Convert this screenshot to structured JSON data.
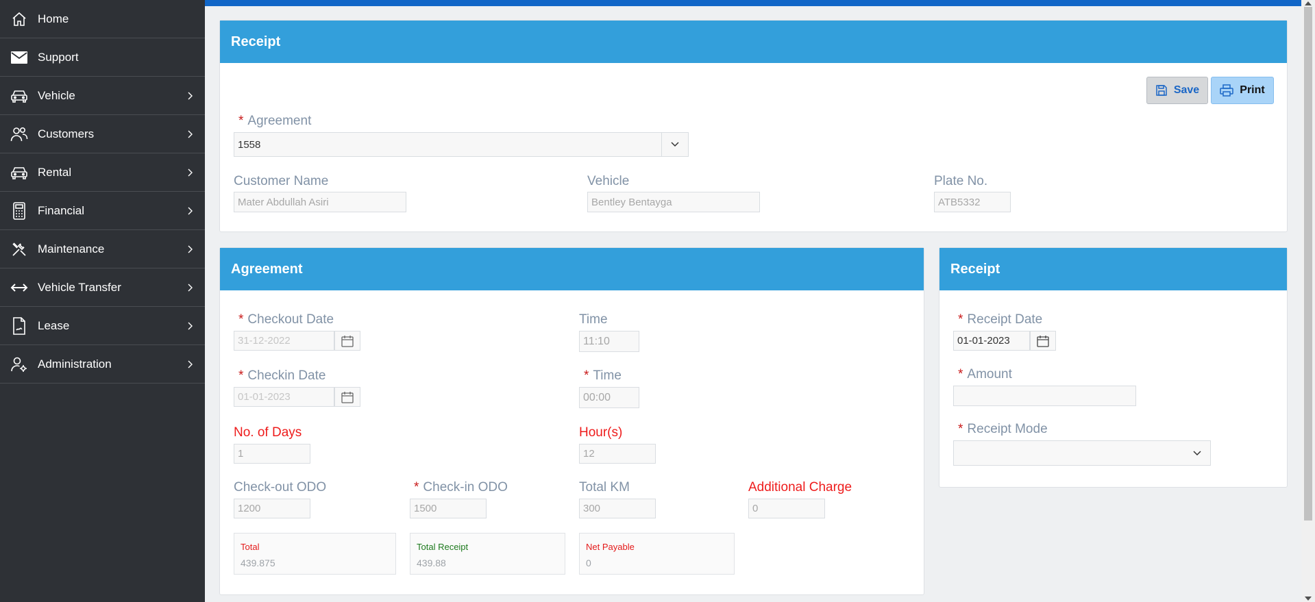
{
  "sidebar": {
    "items": [
      {
        "label": "Home",
        "icon": "home-icon"
      },
      {
        "label": "Support",
        "icon": "envelope-icon"
      },
      {
        "label": "Vehicle",
        "icon": "car-icon"
      },
      {
        "label": "Customers",
        "icon": "users-icon"
      },
      {
        "label": "Rental",
        "icon": "car-icon"
      },
      {
        "label": "Financial",
        "icon": "calculator-icon"
      },
      {
        "label": "Maintenance",
        "icon": "tools-icon"
      },
      {
        "label": "Vehicle Transfer",
        "icon": "arrows-horizontal-icon"
      },
      {
        "label": "Lease",
        "icon": "document-icon"
      },
      {
        "label": "Administration",
        "icon": "user-gear-icon"
      }
    ]
  },
  "receipt_card": {
    "title": "Receipt",
    "save_label": "Save",
    "print_label": "Print",
    "agreement_label": "Agreement",
    "agreement_value": "1558",
    "customer_name_label": "Customer Name",
    "customer_name_value": "Mater Abdullah Asiri",
    "vehicle_label": "Vehicle",
    "vehicle_value": "Bentley Bentayga",
    "plate_label": "Plate No.",
    "plate_value": "ATB5332"
  },
  "agreement_card": {
    "title": "Agreement",
    "checkout_date_label": "Checkout Date",
    "checkout_date_value": "31-12-2022",
    "time_label": "Time",
    "time_value": "11:10",
    "checkin_date_label": "Checkin Date",
    "checkin_date_value": "01-01-2023",
    "checkin_time_label": "Time",
    "checkin_time_value": "00:00",
    "days_label": "No. of Days",
    "days_value": "1",
    "hours_label": "Hour(s)",
    "hours_value": "12",
    "checkout_odo_label": "Check-out ODO",
    "checkout_odo_value": "1200",
    "checkin_odo_label": "Check-in ODO",
    "checkin_odo_value": "1500",
    "total_km_label": "Total KM",
    "total_km_value": "300",
    "additional_charge_label": "Additional Charge",
    "additional_charge_value": "0",
    "total_label": "Total",
    "total_value": "439.875",
    "total_receipt_label": "Total Receipt",
    "total_receipt_value": "439.88",
    "net_payable_label": "Net Payable",
    "net_payable_value": "0"
  },
  "receipt_side": {
    "title": "Receipt",
    "receipt_date_label": "Receipt Date",
    "receipt_date_value": "01-01-2023",
    "amount_label": "Amount",
    "amount_value": "",
    "receipt_mode_label": "Receipt Mode",
    "receipt_mode_value": ""
  },
  "colors": {
    "accent": "#339fdb",
    "topbar": "#1166c7",
    "sidebar": "#2e3136",
    "required": "#c81919",
    "alert_label": "#ee1c1c",
    "positive": "#1e7a1e"
  }
}
